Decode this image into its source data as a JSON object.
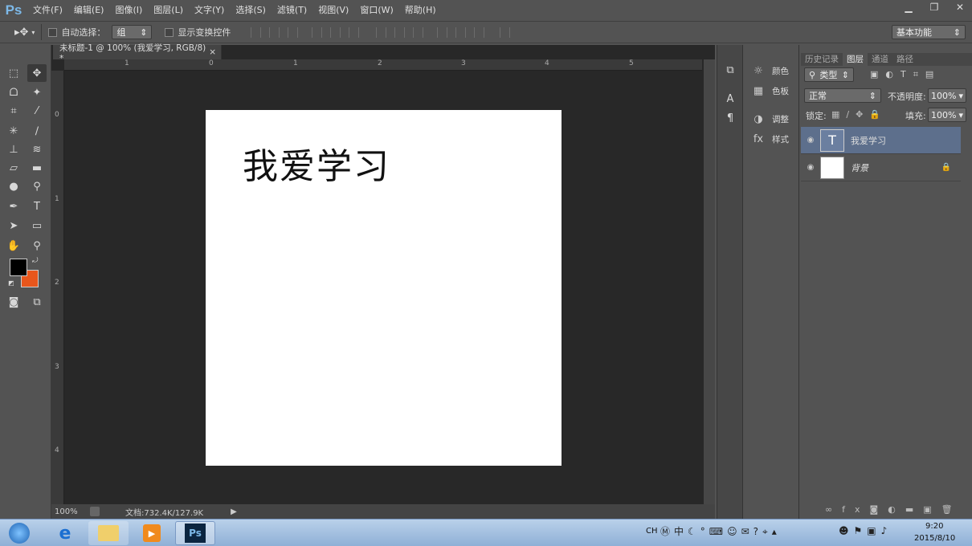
{
  "app": {
    "logo": "Ps"
  },
  "menu": [
    "文件(F)",
    "编辑(E)",
    "图像(I)",
    "图层(L)",
    "文字(Y)",
    "选择(S)",
    "滤镜(T)",
    "视图(V)",
    "窗口(W)",
    "帮助(H)"
  ],
  "options": {
    "auto_select_label": "自动选择：",
    "auto_select_value": "组",
    "show_transform_label": "显示变换控件",
    "workspace": "基本功能"
  },
  "document": {
    "tab_title": "未标题-1 @ 100% (我爱学习, RGB/8) *",
    "canvas_text": "我爱学习",
    "ruler_h": [
      "1",
      "0",
      "1",
      "2",
      "3",
      "4",
      "5"
    ],
    "ruler_v": [
      "0",
      "1",
      "2",
      "3",
      "4"
    ]
  },
  "status": {
    "zoom": "100%",
    "doc_size": "文档:732.4K/127.9K"
  },
  "side_panel": {
    "color": "颜色",
    "swatches": "色板",
    "adjust": "调整",
    "styles": "样式"
  },
  "layers": {
    "tabs": [
      "历史记录",
      "图层",
      "通道",
      "路径"
    ],
    "kind": "类型",
    "blend": "正常",
    "opacity_label": "不透明度:",
    "opacity": "100%",
    "lock_label": "锁定:",
    "fill_label": "填充:",
    "fill": "100%",
    "items": [
      {
        "name": "我爱学习",
        "type": "text"
      },
      {
        "name": "背景",
        "type": "background"
      }
    ]
  },
  "taskbar": {
    "time": "9:20",
    "date": "2015/8/10",
    "lang": "CH"
  },
  "colors": {
    "foreground": "#000000",
    "background": "#e8561c"
  }
}
